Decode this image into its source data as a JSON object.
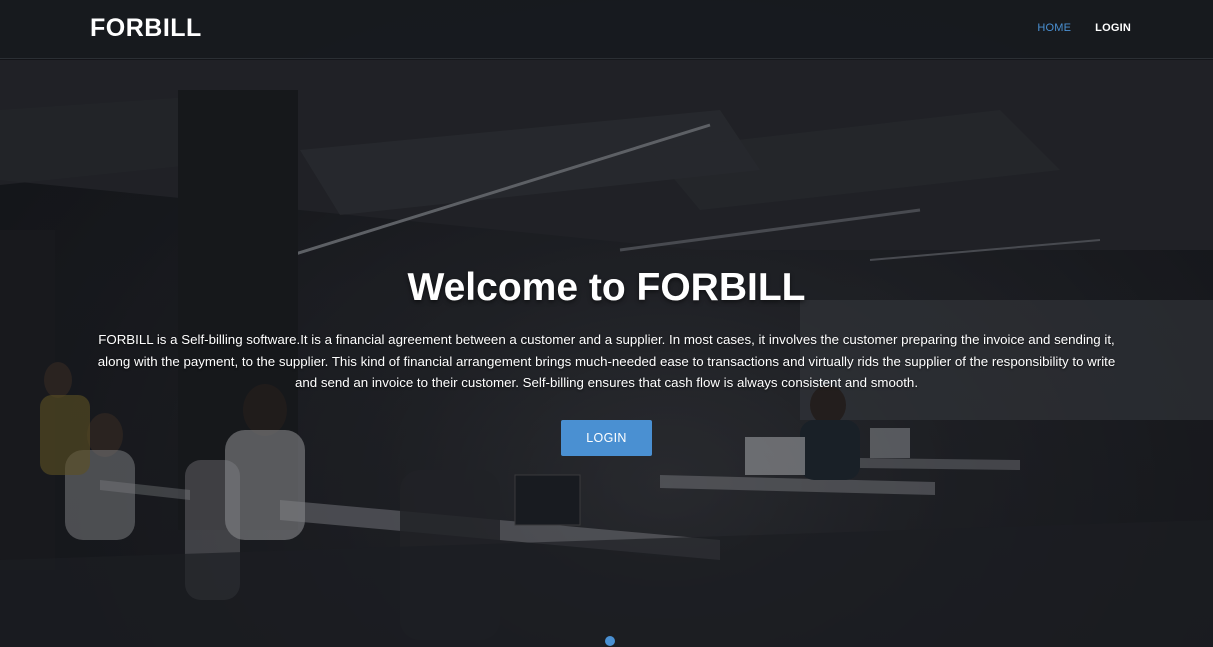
{
  "header": {
    "brand": "FORBILL",
    "nav": [
      {
        "label": "HOME",
        "active": true
      },
      {
        "label": "LOGIN",
        "active": false
      }
    ]
  },
  "hero": {
    "title": "Welcome to FORBILL",
    "description": "FORBILL is a Self-billing software.It is a financial agreement between a customer and a supplier. In most cases, it involves the customer preparing the invoice and sending it, along with the payment, to the supplier. This kind of financial arrangement brings much-needed ease to transactions and virtually rids the supplier of the responsibility to write and send an invoice to their customer. Self-billing ensures that cash flow is always consistent and smooth.",
    "button_label": "LOGIN"
  },
  "colors": {
    "accent": "#4a90d2",
    "header_bg": "#181b1f",
    "text": "#ffffff"
  },
  "icons": [
    "scroll-indicator-dot"
  ]
}
